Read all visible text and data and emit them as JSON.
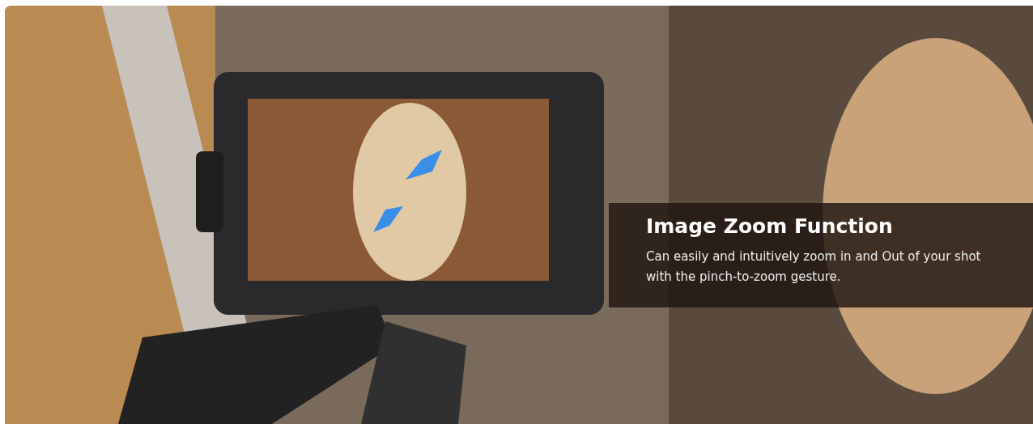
{
  "banner": {
    "caption": {
      "title": "Image Zoom Function",
      "text": "Can easily and intuitively zoom in and Out of your shot with the pinch-to-zoom gesture."
    }
  }
}
